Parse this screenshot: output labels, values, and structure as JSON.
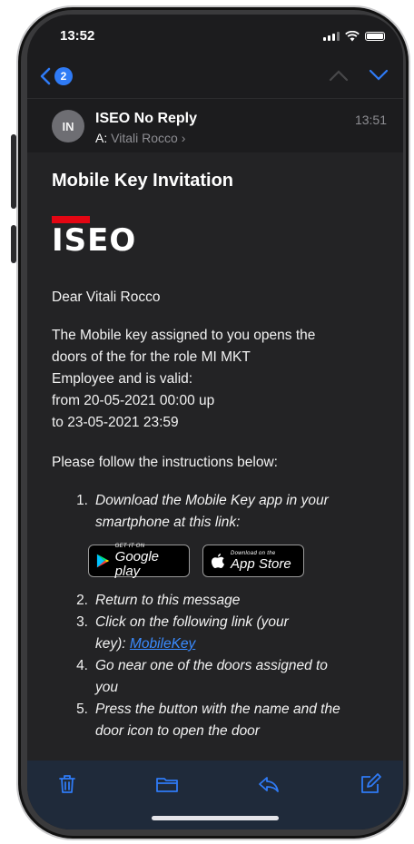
{
  "status": {
    "time": "13:52"
  },
  "nav": {
    "back_count": "2"
  },
  "header": {
    "avatar_initials": "IN",
    "sender": "ISEO No Reply",
    "recipient_prefix": "A:",
    "recipient": "Vitali Rocco",
    "time": "13:51"
  },
  "email": {
    "subject": "Mobile Key Invitation",
    "logo_text": "ISEO",
    "greeting": "Dear Vitali Rocco",
    "para": [
      "The Mobile key assigned to you opens the",
      "doors of the  for the role MI MKT",
      "Employee and is valid:",
      "from 20-05-2021 00:00 up",
      "to  23-05-2021 23:59"
    ],
    "instructions_intro": "Please follow the instructions below:",
    "steps": {
      "s1_num": "1.",
      "s1_a": "Download the Mobile Key app in your",
      "s1_b": "smartphone at this link:",
      "s2_num": "2.",
      "s2": "Return to this message",
      "s3_num": "3.",
      "s3_a": "Click on the following link (your",
      "s3_b": "key): ",
      "s3_link": "MobileKey",
      "s4_num": "4.",
      "s4_a": "Go near one of the doors assigned to",
      "s4_b": "you",
      "s5_num": "5.",
      "s5_a": "Press the button with the name and the",
      "s5_b": "door icon to open the door"
    },
    "google_play": {
      "small": "GET IT ON",
      "big": "Google play"
    },
    "app_store": {
      "small": "Download on the",
      "big": "App Store"
    }
  },
  "icons": [
    "trash-icon",
    "folder-icon",
    "reply-icon",
    "compose-icon"
  ],
  "colors": {
    "accent": "#3a8bff",
    "brand_red": "#e30613",
    "toolbar": "#1f2a3a"
  }
}
